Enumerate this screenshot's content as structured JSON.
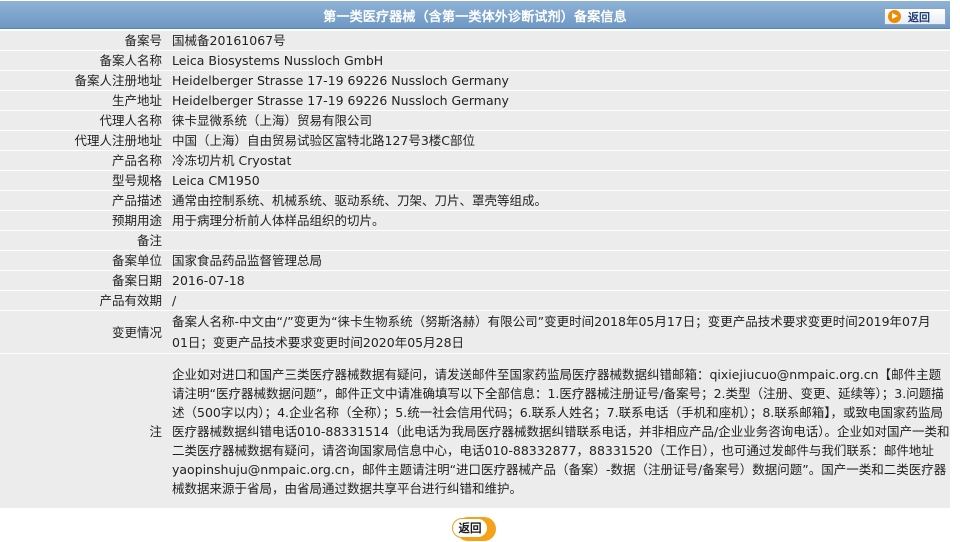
{
  "header": {
    "title": "第一类医疗器械（含第一类体外诊断试剂）备案信息",
    "back_label": "返回"
  },
  "rows": [
    {
      "label": "备案号",
      "value": "国械备20161067号"
    },
    {
      "label": "备案人名称",
      "value": "Leica Biosystems Nussloch GmbH"
    },
    {
      "label": "备案人注册地址",
      "value": "Heidelberger Strasse 17-19 69226 Nussloch Germany"
    },
    {
      "label": "生产地址",
      "value": "Heidelberger Strasse 17-19 69226 Nussloch Germany"
    },
    {
      "label": "代理人名称",
      "value": "徕卡显微系统（上海）贸易有限公司"
    },
    {
      "label": "代理人注册地址",
      "value": "中国（上海）自由贸易试验区富特北路127号3楼C部位"
    },
    {
      "label": "产品名称",
      "value": "冷冻切片机 Cryostat"
    },
    {
      "label": "型号规格",
      "value": "Leica CM1950"
    },
    {
      "label": "产品描述",
      "value": "通常由控制系统、机械系统、驱动系统、刀架、刀片、罩壳等组成。"
    },
    {
      "label": "预期用途",
      "value": "用于病理分析前人体样品组织的切片。"
    },
    {
      "label": "备注",
      "value": ""
    },
    {
      "label": "备案单位",
      "value": "国家食品药品监督管理总局"
    },
    {
      "label": "备案日期",
      "value": "2016-07-18"
    },
    {
      "label": "产品有效期",
      "value": "/"
    }
  ],
  "change": {
    "label": "变更情况",
    "value": "备案人名称-中文由“/”变更为“徕卡生物系统（努斯洛赫）有限公司”变更时间2018年05月17日；变更产品技术要求变更时间2019年07月01日；变更产品技术要求变更时间2020年05月28日"
  },
  "notice": {
    "label": "注",
    "text": "企业如对进口和国产三类医疗器械数据有疑问，请发送邮件至国家药监局医疗器械数据纠错邮箱：qixiejiucuo@nmpaic.org.cn【邮件主题请注明“医疗器械数据问题”，邮件正文中请准确填写以下全部信息：1.医疗器械注册证号/备案号；2.类型（注册、变更、延续等）；3.问题描述（500字以内）；4.企业名称（全称）；5.统一社会信用代码；6.联系人姓名；7.联系电话（手机和座机）；8.联系邮箱】，或致电国家药监局医疗器械数据纠错电话010-88331514（此电话为我局医疗器械数据纠错联系电话，并非相应产品/企业业务咨询电话）。企业如对国产一类和二类医疗器械数据有疑问，请咨询国家局信息中心，电话010-88332877，88331520（工作日），也可通过发邮件与我们联系：邮件地址yaopinshuju@nmpaic.org.cn，邮件主题请注明“进口医疗器械产品（备案）-数据（注册证号/备案号）数据问题”。国产一类和二类医疗器械数据来源于省局，由省局通过数据共享平台进行纠错和维护。"
  },
  "footer": {
    "back_label": "返回"
  },
  "colors": {
    "header_bg": "#7ea6cf",
    "row_bg": "#ececec",
    "accent_orange": "#f3a21a"
  }
}
